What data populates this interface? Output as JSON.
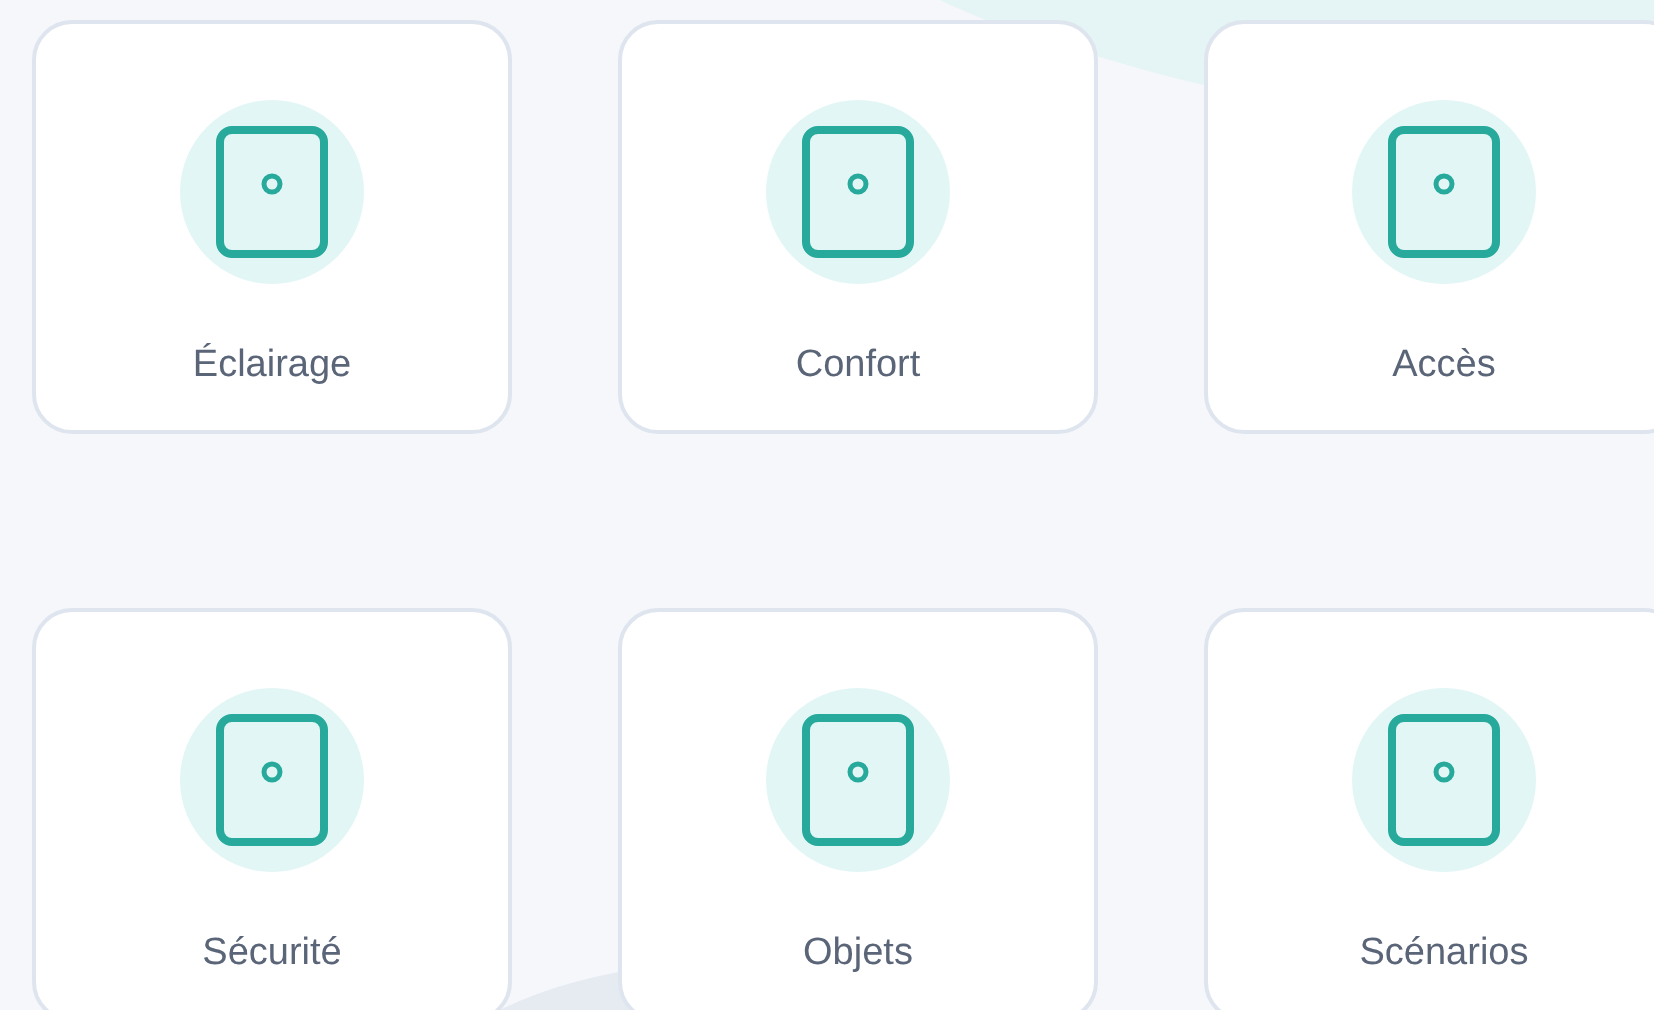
{
  "tiles": [
    {
      "label": "Éclairage"
    },
    {
      "label": "Confort"
    },
    {
      "label": "Accès"
    },
    {
      "label": "Sécurité"
    },
    {
      "label": "Objets"
    },
    {
      "label": "Scénarios"
    }
  ]
}
